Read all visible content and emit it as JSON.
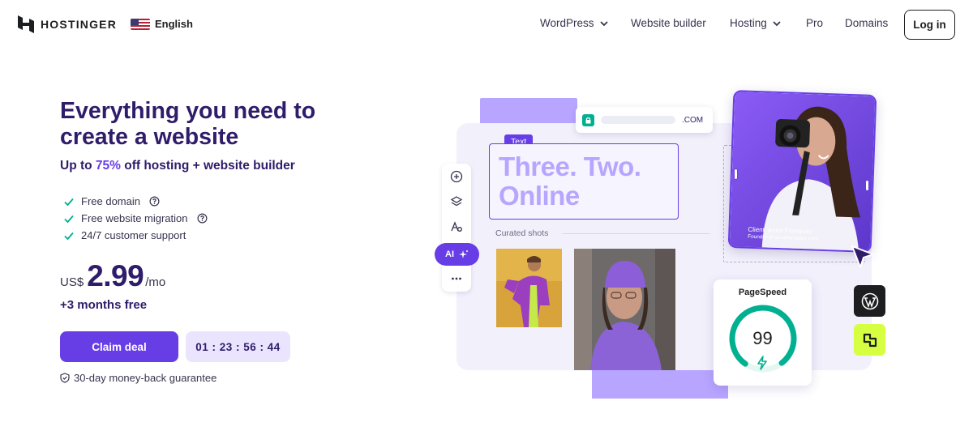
{
  "brand": {
    "name": "HOSTINGER"
  },
  "language": {
    "label": "English"
  },
  "nav": {
    "items": [
      {
        "label": "WordPress",
        "has_dropdown": true
      },
      {
        "label": "Website builder",
        "has_dropdown": false
      },
      {
        "label": "Hosting",
        "has_dropdown": true
      },
      {
        "label": "Pro",
        "has_dropdown": false
      },
      {
        "label": "Domains",
        "has_dropdown": false
      }
    ],
    "login_label": "Log in"
  },
  "hero": {
    "title": "Everything you need to create a website",
    "subtitle_prefix": "Up to ",
    "subtitle_pct": "75%",
    "subtitle_suffix": " off hosting + website builder",
    "features": [
      "Free domain",
      "Free website migration",
      "24/7 customer support"
    ],
    "price": {
      "currency": "US$",
      "amount": "2.99",
      "period": "/mo"
    },
    "bonus": "+3 months free",
    "cta_label": "Claim deal",
    "timer": "01 : 23 : 56 : 44",
    "guarantee": "30-day money-back guarantee"
  },
  "illustration": {
    "domain_suffix": ".COM",
    "text_tag": "Text",
    "headline_line1": "Three. Two.",
    "headline_line2": "Online",
    "curated_label": "Curated shots",
    "ai_label": "AI",
    "client_line1": "Client: Anna Franques",
    "client_line2": "Founder of annafranques.com",
    "pagespeed_label": "PageSpeed",
    "pagespeed_score": "99",
    "pagespeed_value": 0.99
  },
  "colors": {
    "primary": "#673de6",
    "dark_purple": "#2f1c6a",
    "light_purple": "#ebe4ff",
    "check_green": "#00b090",
    "lime": "#d5ff40"
  }
}
